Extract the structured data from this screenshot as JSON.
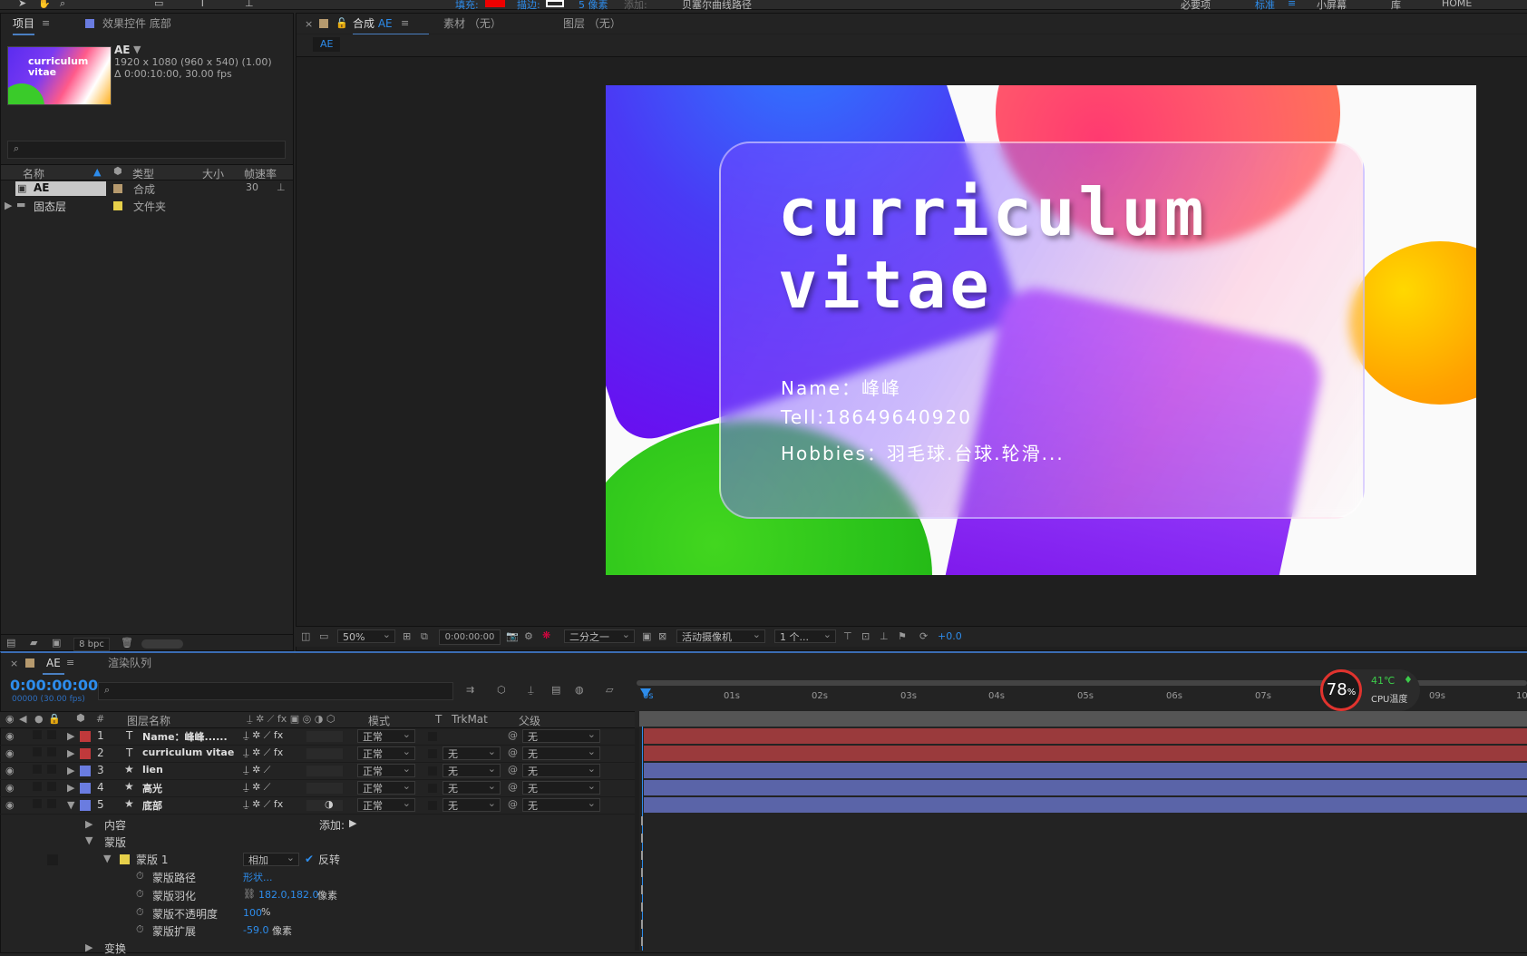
{
  "toolbar": {
    "fill_label": "填充:",
    "stroke_label": "描边:",
    "stroke_width": "5 像素",
    "add_label": "添加:",
    "bezier_label": "贝塞尔曲线路径",
    "workspace_essentials": "必要项",
    "workspace_standard": "标准",
    "workspace_small": "小屏幕",
    "workspace_library": "库",
    "workspace_home": "HOME"
  },
  "project_panel": {
    "tab_project": "项目",
    "tab_effects": "效果控件 底部",
    "comp_name": "AE",
    "comp_info_line1": "1920 x 1080  (960 x 540) (1.00)",
    "comp_info_line2": "Δ 0:00:10:00, 30.00 fps",
    "thumb_text": "curriculum vitae",
    "search_placeholder": "",
    "columns": [
      "名称",
      "类型",
      "大小",
      "帧速率"
    ],
    "items": [
      {
        "name": "AE",
        "type": "合成",
        "size": "",
        "fps": "30",
        "label_color": "#b69a6e"
      },
      {
        "name": "固态层",
        "type": "文件夹",
        "size": "",
        "fps": "",
        "label_color": "#e6d04a"
      }
    ],
    "bpc": "8 bpc"
  },
  "viewer": {
    "tab_comp_prefix": "合成",
    "tab_comp_name": "AE",
    "tab_footage": "素材 （无）",
    "tab_layer": "图层 （无）",
    "subtab": "AE",
    "zoom": "50%",
    "timecode": "0:00:00:00",
    "resolution": "二分之一",
    "camera": "活动摄像机",
    "views": "1 个...",
    "exposure": "+0.0"
  },
  "card": {
    "title_line1": "curriculum",
    "title_line2": "vitae",
    "name_line": "Name：峰峰",
    "tell_line": "Tell:18649640920",
    "hobbies_line": "Hobbies：羽毛球.台球.轮滑..."
  },
  "timeline": {
    "comp_tab": "AE",
    "render_queue_tab": "渲染队列",
    "current_time": "0:00:00:00",
    "frame_info": "00000 (30.00 fps)",
    "columns": {
      "layer_name": "图层名称",
      "mode": "模式",
      "t": "T",
      "trkmat": "TrkMat",
      "parent": "父级"
    },
    "ruler": [
      "0s",
      "01s",
      "02s",
      "03s",
      "04s",
      "05s",
      "06s",
      "07s",
      "09s",
      "10"
    ],
    "layers": [
      {
        "num": "1",
        "icon": "T",
        "name": "Name：峰峰......",
        "mode": "正常",
        "trkmat": "",
        "parent": "无",
        "color": "#c0393b",
        "bar": "#9a3a3c"
      },
      {
        "num": "2",
        "icon": "T",
        "name": "curriculum vitae",
        "mode": "正常",
        "trkmat": "无",
        "parent": "无",
        "color": "#c0393b",
        "bar": "#9a3a3c"
      },
      {
        "num": "3",
        "icon": "★",
        "name": "lien",
        "mode": "正常",
        "trkmat": "无",
        "parent": "无",
        "color": "#6a7ce0",
        "bar": "#5a64a8"
      },
      {
        "num": "4",
        "icon": "★",
        "name": "高光",
        "mode": "正常",
        "trkmat": "无",
        "parent": "无",
        "color": "#6a7ce0",
        "bar": "#5a64a8"
      },
      {
        "num": "5",
        "icon": "★",
        "name": "底部",
        "mode": "正常",
        "trkmat": "无",
        "parent": "无",
        "color": "#6a7ce0",
        "bar": "#5a64a8"
      }
    ],
    "contents_label": "内容",
    "add_label": "添加:",
    "masks_label": "蒙版",
    "mask1_label": "蒙版 1",
    "mask_mode": "相加",
    "invert_label": "反转",
    "mask_path_label": "蒙版路径",
    "mask_path_value": "形状...",
    "mask_feather_label": "蒙版羽化",
    "mask_feather_value": "182.0,182.0",
    "mask_feather_unit": "像素",
    "mask_opacity_label": "蒙版不透明度",
    "mask_opacity_value": "100",
    "mask_opacity_unit": "%",
    "mask_expansion_label": "蒙版扩展",
    "mask_expansion_value": "-59.0",
    "mask_expansion_unit": "像素",
    "transform_label": "变换"
  },
  "cpu_widget": {
    "usage": "78",
    "usage_unit": "%",
    "temp": "41℃",
    "temp_label": "CPU温度"
  }
}
